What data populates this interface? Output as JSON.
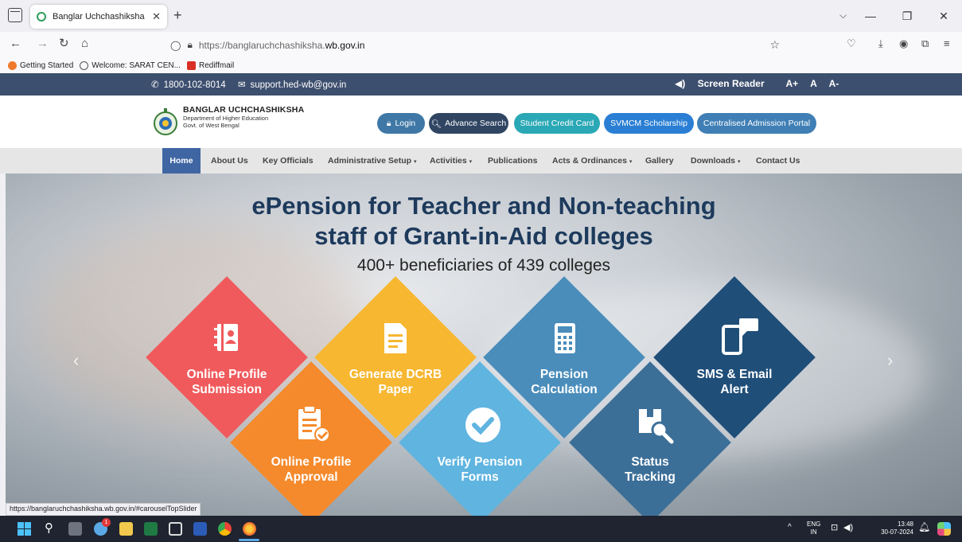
{
  "browser": {
    "tab_title": "Banglar Uchchashiksha",
    "url_prefix": "https://banglaruchchashiksha.",
    "url_domain": "wb.gov.in",
    "bookmarks": [
      "Getting Started",
      "Welcome: SARAT CEN...",
      "Rediffmail"
    ],
    "status_url": "https://banglaruchchashiksha.wb.gov.in/#carouselTopSlider"
  },
  "topbar": {
    "phone": "1800-102-8014",
    "email": "support.hed-wb@gov.in",
    "screen_reader": "Screen Reader",
    "font_larger": "A+",
    "font_normal": "A",
    "font_smaller": "A-"
  },
  "brand": {
    "name": "BANGLAR UCHCHASHIKSHA",
    "dept": "Department of Higher Education",
    "govt": "Govt. of West Bengal"
  },
  "header_buttons": {
    "login": "Login",
    "advance_search": "Advance Search",
    "student_credit_card": "Student Credit Card",
    "svmcm": "SVMCM Scholarship",
    "admission": "Centralised Admission Portal"
  },
  "menu": {
    "home": "Home",
    "about": "About Us",
    "key_officials": "Key Officials",
    "admin_setup": "Administrative Setup",
    "activities": "Activities",
    "publications": "Publications",
    "acts": "Acts & Ordinances",
    "gallery": "Gallery",
    "downloads": "Downloads",
    "contact": "Contact Us"
  },
  "hero": {
    "title_line1": "ePension for Teacher and Non-teaching",
    "title_line2": "staff of Grant-in-Aid colleges",
    "subtitle": "400+ beneficiaries of 439 colleges",
    "tiles": {
      "online_profile_line1": "Online Profile",
      "online_profile_line2": "Submission",
      "dcrb_line1": "Generate DCRB",
      "dcrb_line2": "Paper",
      "pension_line1": "Pension",
      "pension_line2": "Calculation",
      "sms_line1": "SMS & Email",
      "sms_line2": "Alert",
      "approval_line1": "Online Profile",
      "approval_line2": "Approval",
      "verify_line1": "Verify Pension",
      "verify_line2": "Forms",
      "status_line1": "Status",
      "status_line2": "Tracking"
    }
  },
  "taskbar": {
    "lang1": "ENG",
    "lang2": "IN",
    "time": "13:48",
    "date": "30-07-2024",
    "mail_badge": "1"
  },
  "colors": {
    "topbar": "#3d4f6e",
    "tile_red": "#f05a5c",
    "tile_yellow": "#f7b731",
    "tile_blue": "#4a8dbb",
    "tile_navy": "#1f4e79",
    "tile_orange": "#f58a2c",
    "tile_light_blue": "#5fb4e0",
    "tile_steel": "#3c6f98"
  }
}
